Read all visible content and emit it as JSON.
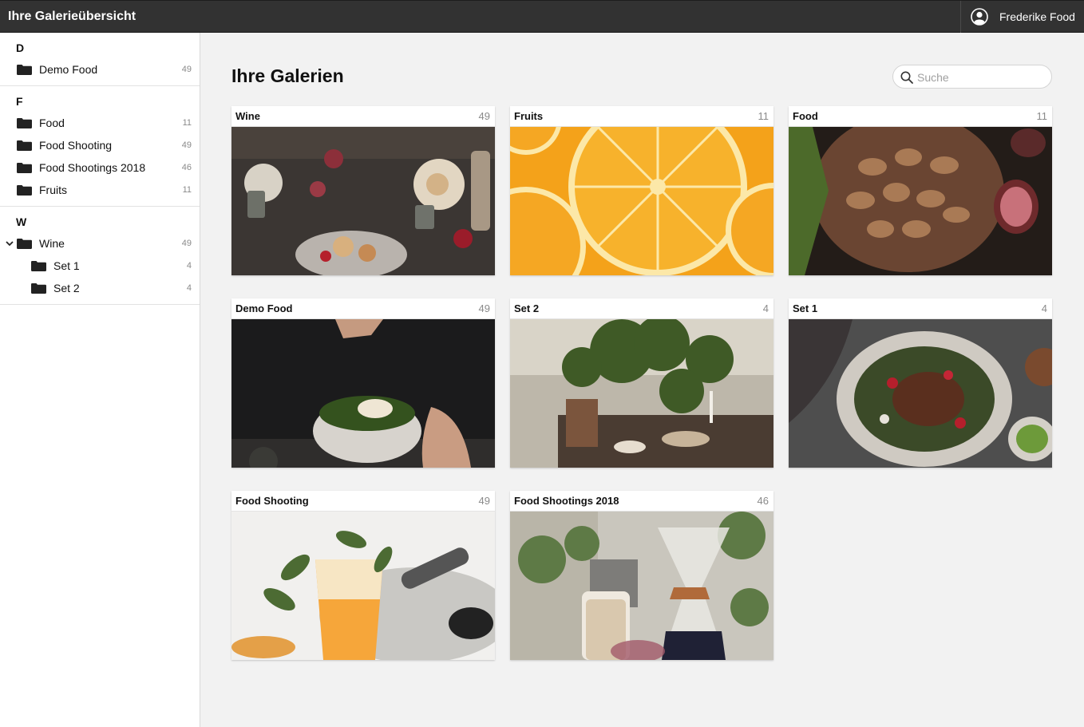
{
  "app": {
    "title": "Ihre Galerieübersicht"
  },
  "user": {
    "name": "Frederike Food",
    "icon": "user-circle-icon"
  },
  "sidebar": {
    "groups": [
      {
        "letter": "D",
        "items": [
          {
            "label": "Demo Food",
            "count": "49"
          }
        ]
      },
      {
        "letter": "F",
        "items": [
          {
            "label": "Food",
            "count": "11"
          },
          {
            "label": "Food Shooting",
            "count": "49"
          },
          {
            "label": "Food Shootings 2018",
            "count": "46"
          },
          {
            "label": "Fruits",
            "count": "11"
          }
        ]
      },
      {
        "letter": "W",
        "items": [
          {
            "label": "Wine",
            "count": "49",
            "expanded": true
          },
          {
            "label": "Set 1",
            "count": "4"
          },
          {
            "label": "Set 2",
            "count": "4"
          }
        ]
      }
    ]
  },
  "main": {
    "title": "Ihre Galerien",
    "search": {
      "placeholder": "Suche",
      "value": ""
    },
    "galleries": [
      {
        "title": "Wine",
        "count": "49",
        "image": "wine-table-photo"
      },
      {
        "title": "Fruits",
        "count": "11",
        "image": "orange-slices-photo"
      },
      {
        "title": "Food",
        "count": "11",
        "image": "almonds-figs-photo"
      },
      {
        "title": "Demo Food",
        "count": "49",
        "image": "salad-bowl-photo"
      },
      {
        "title": "Set 2",
        "count": "4",
        "image": "garden-table-photo"
      },
      {
        "title": "Set 1",
        "count": "4",
        "image": "salad-plate-photo"
      },
      {
        "title": "Food Shooting",
        "count": "49",
        "image": "cocktail-glass-photo"
      },
      {
        "title": "Food Shootings 2018",
        "count": "46",
        "image": "coffee-chemex-photo"
      }
    ]
  },
  "colors": {
    "topbar": "#323232",
    "sidebar": "#ffffff",
    "background": "#f2f2f2",
    "accent": "#111111"
  }
}
